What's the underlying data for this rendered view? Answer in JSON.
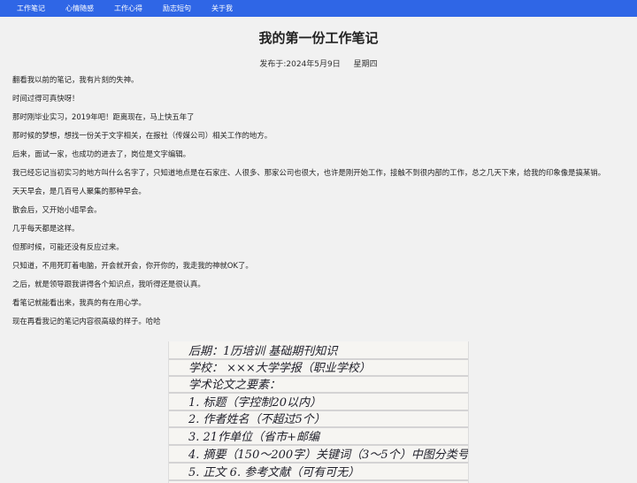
{
  "nav": {
    "items": [
      "工作笔记",
      "心情随感",
      "工作心得",
      "励志短句",
      "关于我"
    ]
  },
  "article": {
    "title": "我的第一份工作笔记",
    "published": "发布于:2024年5月9日",
    "weekday": "星期四",
    "paragraphs": [
      "翻看我以前的笔记，我有片刻的失神。",
      "时间过得可真快呀！",
      "那时刚毕业实习，2019年吧！距离现在，马上快五年了",
      "那时候的梦想，想找一份关于文字相关，在报社（传媒公司）相关工作的地方。",
      "后来，面试一家，也成功的进去了，岗位是文字编辑。",
      "我已经忘记当初实习的地方叫什么名字了，只知道地点是在石家庄、人很多、那家公司也很大，也许是刚开始工作，接触不到很内部的工作，总之几天下来，给我的印象像是搞某销。",
      "天天早会，是几百号人聚集的那种早会。",
      "散会后，又开始小组早会。",
      "几乎每天都是这样。",
      "但那时候，可能还没有反应过来。",
      "只知道，不用死盯着电脑，开会就开会，你开你的，我走我的神就OK了。",
      "之后，就是领导跟我讲得各个知识点，我听得还是很认真。",
      "看笔记就能看出来，我真的有在用心学。",
      "现在再看我记的笔记内容很高级的样子。哈哈"
    ]
  },
  "notebook_lines": [
    "后期：1历培训     基础期刊知识",
    "学校：  ×××大学学报（职业学校）",
    "学术论文之要素：",
    "1. 标题（字控制20以内）",
    "2. 作者姓名（不超过5个）",
    "3. 21作单位（省市+邮编",
    "4. 摘要（150～200字）关键词（3～5个）中图分类号",
    "5. 正文          6. 参考文献（可有可无）"
  ]
}
